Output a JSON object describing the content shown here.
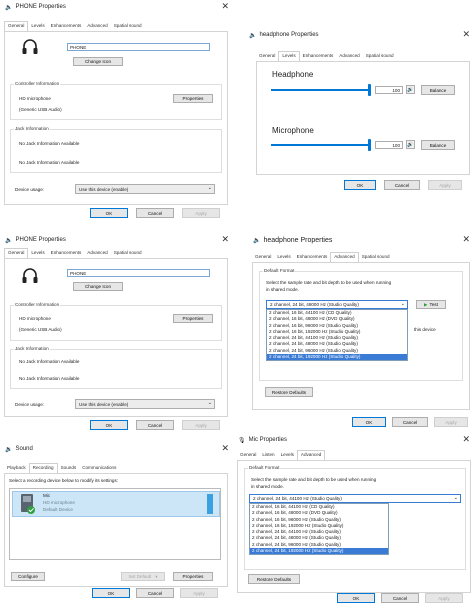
{
  "common": {
    "ok": "OK",
    "cancel": "Cancel",
    "apply": "Apply",
    "close_glyph": "✕"
  },
  "phone1": {
    "title": "PHONE Properties",
    "tabs": [
      "General",
      "Levels",
      "Enhancements",
      "Advanced",
      "Spatial sound"
    ],
    "name_value": "PHONE",
    "change_icon": "Change Icon",
    "controller_label": "Controller Information",
    "controller_name": "HD microphone",
    "controller_sub": "(Generic USB Audio)",
    "properties_btn": "Properties",
    "jack_label": "Jack Information",
    "jack_line1": "No Jack Information Available",
    "jack_line2": "No Jack Information Available",
    "usage_label": "Device usage:",
    "usage_value": "Use this device (enable)"
  },
  "headphone_levels": {
    "title": "headphone Properties",
    "tabs": [
      "General",
      "Levels",
      "Enhancements",
      "Advanced",
      "Spatial sound"
    ],
    "headphone_label": "Headphone",
    "headphone_value": "100",
    "headphone_level": 1.0,
    "microphone_label": "Microphone",
    "microphone_value": "100",
    "microphone_level": 1.0,
    "balance": "Balance"
  },
  "phone2": {
    "title": "PHONE Properties",
    "tabs": [
      "General",
      "Levels",
      "Enhancements",
      "Advanced",
      "Spatial sound"
    ],
    "name_value": "PHONE",
    "change_icon": "Change Icon",
    "controller_label": "Controller Information",
    "controller_name": "HD microphone",
    "controller_sub": "(Generic USB Audio)",
    "properties_btn": "Properties",
    "jack_label": "Jack Information",
    "jack_line1": "No Jack Information Available",
    "jack_line2": "No Jack Information Available",
    "usage_label": "Device usage:",
    "usage_value": "Use this device (enable)"
  },
  "headphone_adv": {
    "title": "headphone Properties",
    "tabs": [
      "General",
      "Levels",
      "Enhancements",
      "Advanced",
      "Spatial sound"
    ],
    "default_format": "Default Format",
    "desc1": "Select the sample rate and bit depth to be used when running",
    "desc2": "in shared mode.",
    "selected": "2 channel, 24 bit, 48000 Hz (Studio Quality)",
    "test": "Test",
    "options": [
      "2 channel, 16 bit, 44100 Hz (CD Quality)",
      "2 channel, 16 bit, 48000 Hz (DVD Quality)",
      "2 channel, 16 bit, 96000 Hz (Studio Quality)",
      "2 channel, 16 bit, 192000 Hz (Studio Quality)",
      "2 channel, 24 bit, 44100 Hz (Studio Quality)",
      "2 channel, 24 bit, 48000 Hz (Studio Quality)",
      "2 channel, 24 bit, 96000 Hz (Studio Quality)",
      "2 channel, 24 bit, 192000 Hz (Studio Quality)"
    ],
    "side_text": "this device",
    "restore": "Restore Defaults"
  },
  "sound": {
    "title": "Sound",
    "tabs": [
      "Playback",
      "Recording",
      "Sounds",
      "Communications"
    ],
    "instruction": "Select a recording device below to modify its settings:",
    "dev_name": "Mic",
    "dev_sub1": "HD microphone",
    "dev_sub2": "Default Device",
    "configure": "Configure",
    "set_default": "Set Default",
    "properties": "Properties"
  },
  "mic_adv": {
    "title": "Mic Properties",
    "tabs": [
      "General",
      "Listen",
      "Levels",
      "Advanced"
    ],
    "default_format": "Default Format",
    "desc1": "Select the sample rate and bit depth to be used when running",
    "desc2": "in shared mode.",
    "selected": "2 channel, 24 bit, 44100 Hz (Studio Quality)",
    "options": [
      "2 channel, 16 bit, 44100 Hz (CD Quality)",
      "2 channel, 16 bit, 48000 Hz (DVD Quality)",
      "2 channel, 16 bit, 96000 Hz (Studio Quality)",
      "2 channel, 16 bit, 192000 Hz (Studio Quality)",
      "2 channel, 24 bit, 44100 Hz (Studio Quality)",
      "2 channel, 24 bit, 48000 Hz (Studio Quality)",
      "2 channel, 24 bit, 96000 Hz (Studio Quality)",
      "2 channel, 24 bit, 192000 Hz (Studio Quality)"
    ],
    "restore": "Restore Defaults"
  }
}
